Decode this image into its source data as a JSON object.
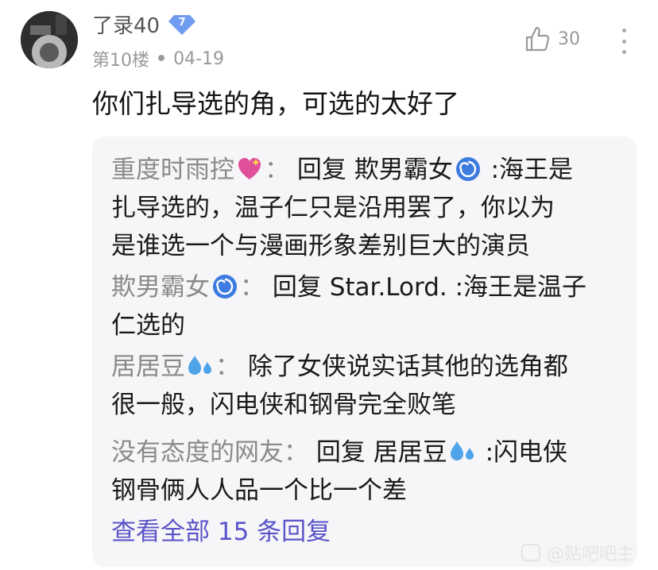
{
  "comment": {
    "username": "了录40",
    "level": "7",
    "floor": "第10楼",
    "date": "04-19",
    "likes": "30",
    "text": "你们扎导选的角，可选的太好了"
  },
  "replies": [
    {
      "name": "重度时雨控",
      "emoji": "sparkling-heart-emoji",
      "sep": "：",
      "reply_label": "回复",
      "target": "欺男霸女",
      "target_emoji": "cyclone-emoji",
      "line1_rest": ":海王是",
      "line2": "扎导选的，温子仁只是沿用罢了，你以为",
      "line3": "是谁选一个与漫画形象差别巨大的演员"
    },
    {
      "name": "欺男霸女",
      "emoji": "cyclone-emoji",
      "sep": "：",
      "reply_label": "回复",
      "target": "Star.Lord.",
      "line1_rest": ":海王是温子",
      "line2": "仁选的"
    },
    {
      "name": "居居豆",
      "emoji": "sweat-droplets-emoji",
      "sep": "：",
      "line1_rest": "除了女侠说实话其他的选角都",
      "line2": "很一般，闪电侠和钢骨完全败笔"
    },
    {
      "name": "没有态度的网友",
      "sep": "：",
      "reply_label": "回复",
      "target": "居居豆",
      "target_emoji": "sweat-droplets-emoji",
      "line1_rest": ":闪电侠",
      "line2": "钢骨俩人人品一个比一个差"
    }
  ],
  "view_all": "查看全部 15 条回复",
  "watermark": "@贴吧吧主",
  "colors": {
    "reply_name": "#8a8a8a",
    "link": "#5b54c8",
    "panel_bg": "#f6f6f9",
    "badge": "#6f9bf0"
  }
}
